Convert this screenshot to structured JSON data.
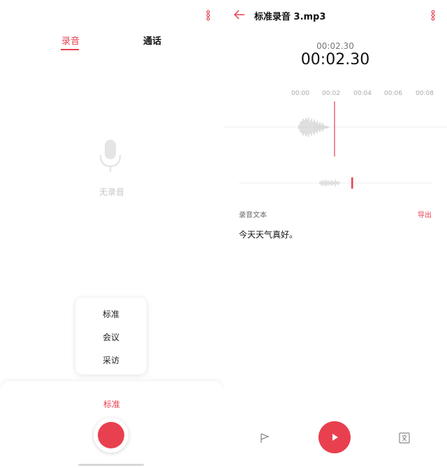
{
  "left": {
    "tabs": [
      {
        "label": "录音",
        "active": true
      },
      {
        "label": "通话",
        "active": false
      }
    ],
    "empty_state": "无录音",
    "mode_menu": [
      "标准",
      "会议",
      "采访"
    ],
    "selected_mode": "标准",
    "icons": {
      "menu": "more-vert-icon",
      "mic": "microphone-icon",
      "record": "record-icon"
    }
  },
  "right": {
    "title": "标准录音 3.mp3",
    "time_small": "00:02.30",
    "time_big": "00:02.30",
    "ruler_ticks": [
      "00:00",
      "00:02",
      "00:04",
      "00:06",
      "00:08"
    ],
    "transcript_label": "录音文本",
    "export_label": "导出",
    "transcript_text": "今天天气真好。",
    "icons": {
      "back": "arrow-left-icon",
      "menu": "more-vert-icon",
      "flag": "flag-icon",
      "play": "play-icon",
      "text": "text-icon"
    }
  },
  "colors": {
    "accent": "#e8404f",
    "waveform": "#c9c9c9",
    "muted": "#c6c6c6"
  }
}
